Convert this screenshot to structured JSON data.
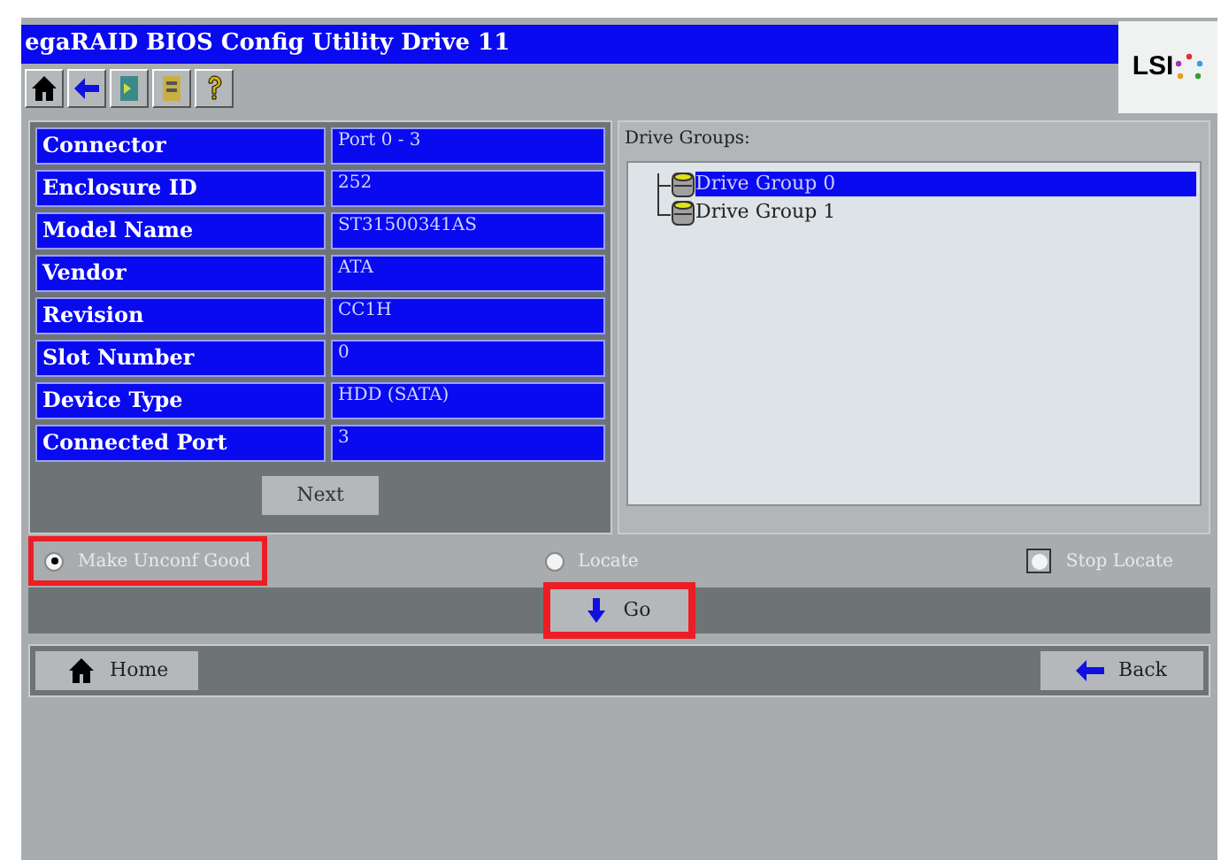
{
  "window": {
    "title": "egaRAID BIOS Config Utility Drive 11"
  },
  "logo": {
    "text": "LSI"
  },
  "toolbar": {
    "buttons": [
      {
        "kind": "home"
      },
      {
        "kind": "back"
      },
      {
        "kind": "exit"
      },
      {
        "kind": "events"
      },
      {
        "kind": "help"
      }
    ]
  },
  "properties": [
    {
      "label": "Connector",
      "value": "Port 0 - 3"
    },
    {
      "label": "Enclosure ID",
      "value": "252"
    },
    {
      "label": "Model Name",
      "value": "ST31500341AS"
    },
    {
      "label": "Vendor",
      "value": "ATA"
    },
    {
      "label": "Revision",
      "value": "CC1H"
    },
    {
      "label": "Slot Number",
      "value": "0"
    },
    {
      "label": "Device Type",
      "value": "HDD (SATA)"
    },
    {
      "label": "Connected Port",
      "value": "3"
    }
  ],
  "next_button": {
    "label": "Next"
  },
  "drive_groups": {
    "title": "Drive Groups:",
    "items": [
      {
        "label": "Drive Group 0",
        "selected": true
      },
      {
        "label": "Drive Group 1",
        "selected": false
      }
    ]
  },
  "actions": [
    {
      "label": "Make Unconf Good",
      "kind": "radio",
      "selected": true,
      "highlighted": true
    },
    {
      "label": "Locate",
      "kind": "radio",
      "selected": false,
      "highlighted": false
    },
    {
      "label": "Stop Locate",
      "kind": "square",
      "selected": false,
      "highlighted": false
    }
  ],
  "go_button": {
    "label": "Go",
    "highlighted": true
  },
  "home_button": {
    "label": "Home"
  },
  "back_button": {
    "label": "Back"
  }
}
